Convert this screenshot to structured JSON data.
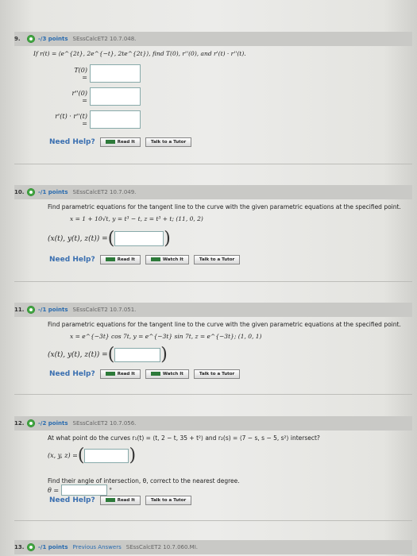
{
  "q9": {
    "num": "9.",
    "points": "-/3 points",
    "source": "SEssCalcET2 10.7.048.",
    "prompt": "If r(t) = ⟨e^{2t}, 2e^{−t}, 2te^{2t}⟩, find T(0), r''(0), and r'(t) · r''(t).",
    "row1": "T(0) =",
    "row2": "r''(0) =",
    "row3": "r'(t) · r''(t) ="
  },
  "q10": {
    "num": "10.",
    "points": "-/1 points",
    "source": "SEssCalcET2 10.7.049.",
    "prompt": "Find parametric equations for the tangent line to the curve with the given parametric equations at the specified point.",
    "equations": "x = 1 + 10√t, y = t³ − t, z = t³ + t; (11, 0, 2)",
    "lhs": "(x(t), y(t), z(t)) ="
  },
  "q11": {
    "num": "11.",
    "points": "-/1 points",
    "source": "SEssCalcET2 10.7.051.",
    "prompt": "Find parametric equations for the tangent line to the curve with the given parametric equations at the specified point.",
    "equations": "x = e^{−3t} cos 7t, y = e^{−3t} sin 7t, z = e^{−3t}; (1, 0, 1)",
    "lhs": "(x(t), y(t), z(t)) ="
  },
  "q12": {
    "num": "12.",
    "points": "-/2 points",
    "source": "SEssCalcET2 10.7.056.",
    "prompt": "At what point do the curves r₁(t) = ⟨t, 2 − t, 35 + t²⟩ and r₂(s) = ⟨7 − s, s − 5, s²⟩ intersect?",
    "lhs": "(x, y, z) =",
    "angle_prompt": "Find their angle of intersection, θ, correct to the nearest degree.",
    "theta": "θ =",
    "degree": "°"
  },
  "q13": {
    "num": "13.",
    "points": "-/1 points",
    "prev": "Previous Answers",
    "source": "SEssCalcET2 10.7.060.MI."
  },
  "help": {
    "need_help": "Need Help?",
    "read_it": "Read It",
    "watch_it": "Watch It",
    "talk": "Talk to a Tutor"
  }
}
